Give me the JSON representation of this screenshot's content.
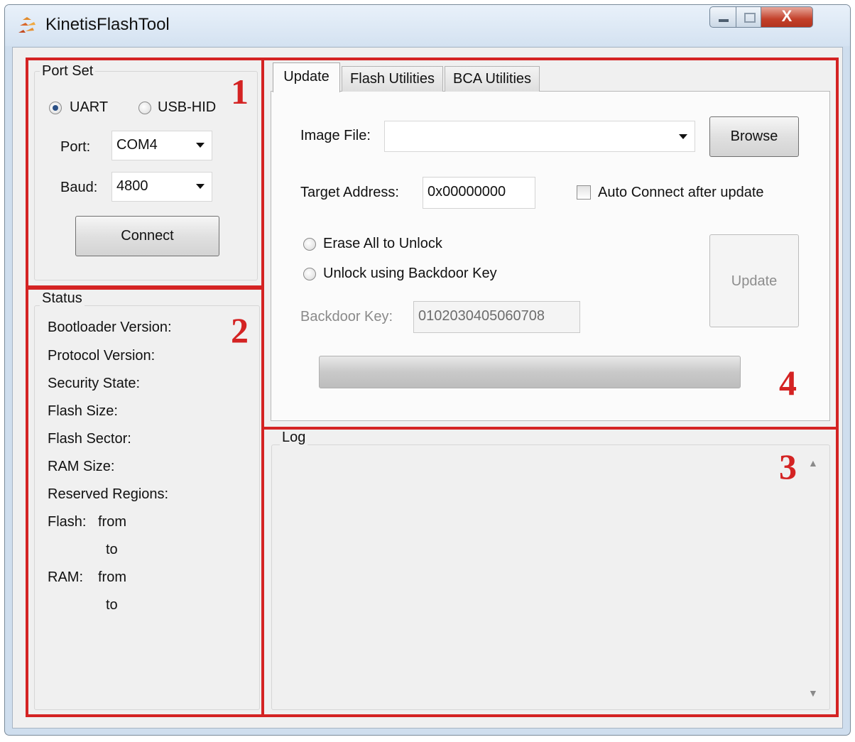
{
  "window": {
    "title": "KinetisFlashTool",
    "close_label": "X"
  },
  "port_set": {
    "group_label": "Port Set",
    "radio_uart": "UART",
    "radio_usb_hid": "USB-HID",
    "port_label": "Port:",
    "port_value": "COM4",
    "baud_label": "Baud:",
    "baud_value": "4800",
    "connect_label": "Connect",
    "marker": "1"
  },
  "status": {
    "group_label": "Status",
    "marker": "2",
    "bootloader_version": "Bootloader Version:",
    "protocol_version": "Protocol Version:",
    "security_state": "Security State:",
    "flash_size": "Flash Size:",
    "flash_sector": "Flash Sector:",
    "ram_size": "RAM Size:",
    "reserved_regions": "Reserved Regions:",
    "flash_label": "Flash:",
    "ram_label": "RAM:",
    "from": "from",
    "to": "to"
  },
  "tabs": {
    "update": "Update",
    "flash_utilities": "Flash Utilities",
    "bca_utilities": "BCA Utilities"
  },
  "update_panel": {
    "marker": "4",
    "image_file_label": "Image File:",
    "image_file_value": "",
    "browse_label": "Browse",
    "target_address_label": "Target Address:",
    "target_address_value": "0x00000000",
    "auto_connect_label": "Auto Connect after update",
    "erase_all_label": "Erase All to Unlock",
    "unlock_backdoor_label": "Unlock using Backdoor Key",
    "backdoor_key_label": "Backdoor Key:",
    "backdoor_key_value": "0102030405060708",
    "update_button_label": "Update",
    "progress": 0
  },
  "log": {
    "group_label": "Log",
    "marker": "3"
  },
  "colors": {
    "highlight": "#d42323",
    "window_bg": "#f0f0f0",
    "titlebar": "#dbe7f4"
  }
}
